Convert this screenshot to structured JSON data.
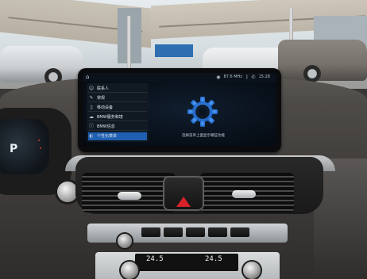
{
  "status_bar": {
    "home_icon": "home-icon",
    "signal": "87.6 MHz",
    "time": "15:28"
  },
  "settings_menu": {
    "items": [
      {
        "icon": "user-icon",
        "label": "联系人",
        "selected": false
      },
      {
        "icon": "wrench-icon",
        "label": "常规",
        "selected": false
      },
      {
        "icon": "phone-icon",
        "label": "移动设备",
        "selected": false
      },
      {
        "icon": "cloud-icon",
        "label": "BMW服务和境",
        "selected": false
      },
      {
        "icon": "info-icon",
        "label": "BMW信息",
        "selected": false
      },
      {
        "icon": "person-icon",
        "label": "个性化菜单",
        "selected": true
      }
    ]
  },
  "main_pane": {
    "icon": "gear-icon",
    "caption": "选择菜单上面显示哪些功能"
  },
  "climate": {
    "left_temp": "24.5",
    "right_temp": "24.5"
  },
  "colors": {
    "screen_bg": "#08101a",
    "selected_item": "#1e5fb2",
    "gear": "#2a7be0",
    "hazard": "#d6232a"
  }
}
